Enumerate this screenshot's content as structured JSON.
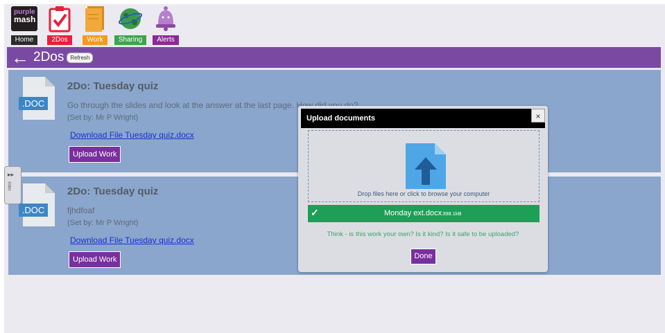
{
  "nav": {
    "logo_top": "purple",
    "logo_bottom": "mash",
    "items": [
      {
        "label": "Home",
        "icon": "purple-mash-logo"
      },
      {
        "label": "2Dos",
        "icon": "checklist-icon"
      },
      {
        "label": "Work",
        "icon": "folder-icon"
      },
      {
        "label": "Sharing",
        "icon": "globe-icon"
      },
      {
        "label": "Alerts",
        "icon": "bell-icon"
      }
    ]
  },
  "header": {
    "back_glyph": "←",
    "title": "2Dos",
    "refresh_label": "Refresh"
  },
  "tasks": [
    {
      "doc_type": ".DOC",
      "title": "2Do: Tuesday quiz",
      "description": "Go through the slides and look at the answer at the last page. How did you do?",
      "set_by": "(Set by: Mr P Wright)",
      "download_label": "Download File Tuesday quiz.docx",
      "upload_label": "Upload Work"
    },
    {
      "doc_type": ".DOC",
      "title": "2Do: Tuesday quiz",
      "description": "fjhdfoaf",
      "set_by": "(Set by: Mr P Wright)",
      "download_label": "Download File Tuesday quiz.docx",
      "upload_label": "Upload Work"
    }
  ],
  "modal": {
    "title": "Upload documents",
    "close_glyph": "×",
    "drop_text": "Drop files here or click to browse your computer",
    "file": {
      "name": "Monday ext.docx",
      "size": "398.1kB",
      "check_glyph": "✓"
    },
    "note": "Think - is this work your own? Is it kind? Is it safe to be uploaded?",
    "done_label": "Done"
  },
  "colors": {
    "header_purple": "#7a4aa3",
    "card_blue": "#8aa6cc",
    "button_purple": "#7a2fa0",
    "file_green": "#1e9e56"
  }
}
